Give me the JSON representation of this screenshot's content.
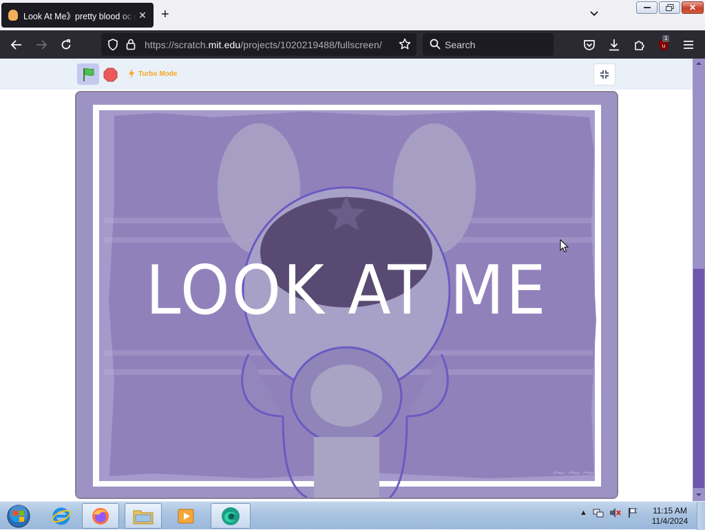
{
  "browser": {
    "tab": {
      "title": "Look At Me》pretty blood oc oc",
      "favicon": "scratch-favicon"
    },
    "url": {
      "prefix": "https://scratch.",
      "domain": "mit.edu",
      "path": "/projects/1020219488/fullscreen/"
    },
    "search_placeholder": "Search",
    "extensions_badge": "1"
  },
  "scratch": {
    "turbo_label": "Turbo Mode",
    "stage_text": "LOOK AT ME"
  },
  "taskbar": {
    "time": "11:15 AM",
    "date": "11/4/2024"
  },
  "colors": {
    "stage_bg": "#9c8fc3",
    "turbo": "#f5a623",
    "browser_dark": "#2b2a33"
  }
}
